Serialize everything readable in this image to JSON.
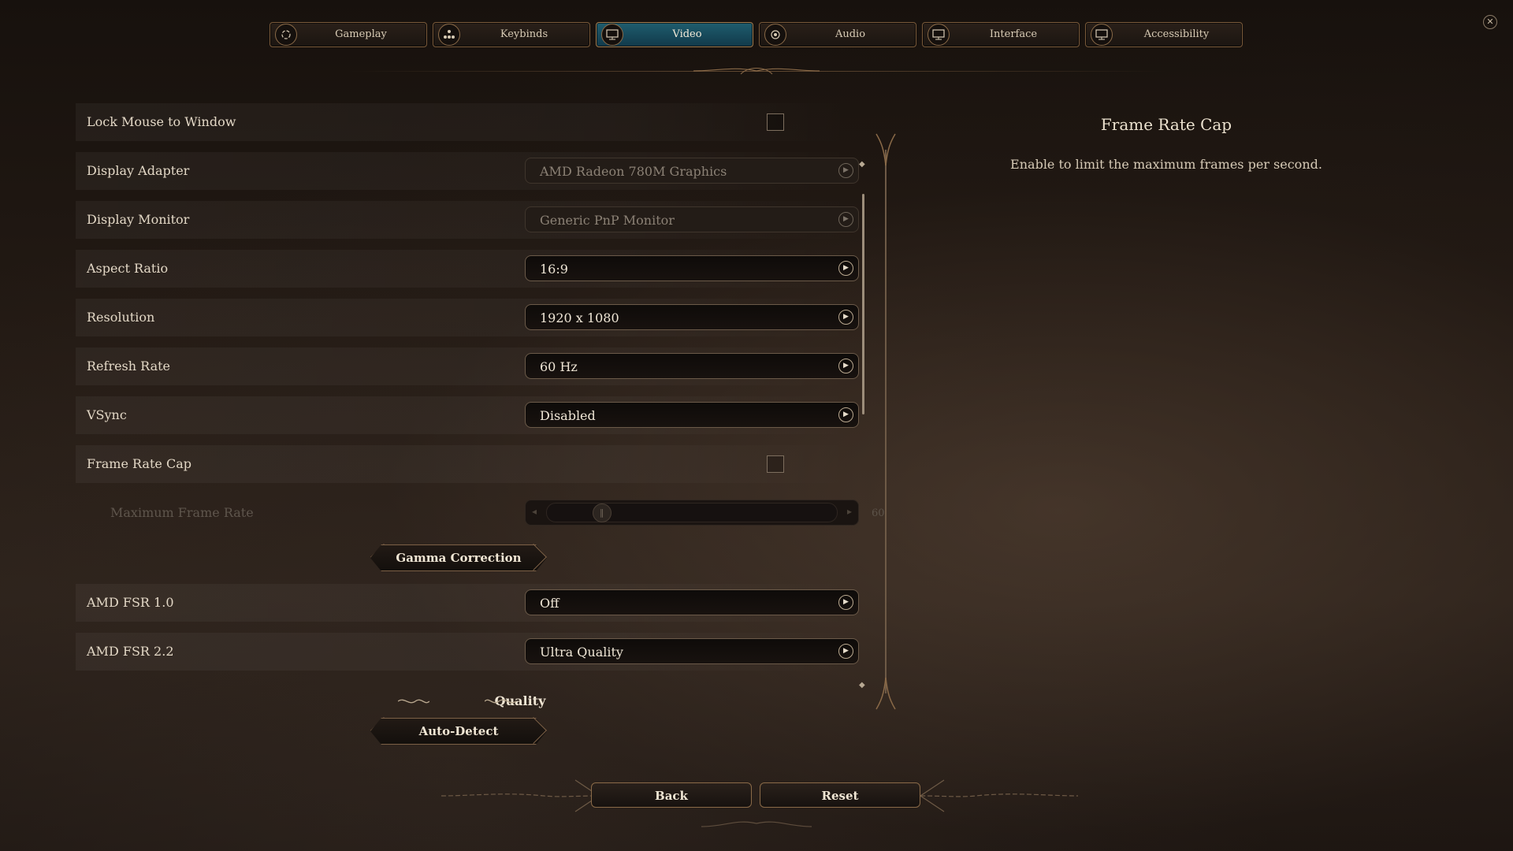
{
  "tabs": [
    {
      "label": "Gameplay",
      "icon": "gameplay-icon",
      "active": false
    },
    {
      "label": "Keybinds",
      "icon": "keybinds-icon",
      "active": false
    },
    {
      "label": "Video",
      "icon": "monitor-icon",
      "active": true
    },
    {
      "label": "Audio",
      "icon": "audio-icon",
      "active": false
    },
    {
      "label": "Interface",
      "icon": "monitor-icon",
      "active": false
    },
    {
      "label": "Accessibility",
      "icon": "monitor-icon",
      "active": false
    }
  ],
  "close_glyph": "✕",
  "settings": {
    "lock_mouse": {
      "label": "Lock Mouse to Window",
      "checked": false
    },
    "display_adapter": {
      "label": "Display Adapter",
      "value": "AMD Radeon 780M Graphics",
      "enabled": false
    },
    "display_monitor": {
      "label": "Display Monitor",
      "value": "Generic PnP Monitor",
      "enabled": false
    },
    "aspect_ratio": {
      "label": "Aspect Ratio",
      "value": "16:9"
    },
    "resolution": {
      "label": "Resolution",
      "value": "1920 x 1080"
    },
    "refresh_rate": {
      "label": "Refresh Rate",
      "value": "60 Hz"
    },
    "vsync": {
      "label": "VSync",
      "value": "Disabled"
    },
    "frame_rate_cap": {
      "label": "Frame Rate Cap",
      "checked": false
    },
    "max_frame_rate": {
      "label": "Maximum Frame Rate",
      "value": "60",
      "fraction": 0.19,
      "enabled": false
    },
    "gamma_correction": {
      "label": "Gamma Correction"
    },
    "fsr1": {
      "label": "AMD FSR 1.0",
      "value": "Off"
    },
    "fsr2": {
      "label": "AMD FSR 2.2",
      "value": "Ultra Quality"
    }
  },
  "quality_section": {
    "label": "Quality",
    "auto_detect": "Auto-Detect"
  },
  "info_panel": {
    "title": "Frame Rate Cap",
    "description": "Enable to limit the maximum frames per second."
  },
  "footer": {
    "back": "Back",
    "reset": "Reset"
  },
  "colors": {
    "accent_tab": "#1f5d6e",
    "border_gold": "#8a6a48",
    "text": "#e6dccb"
  }
}
